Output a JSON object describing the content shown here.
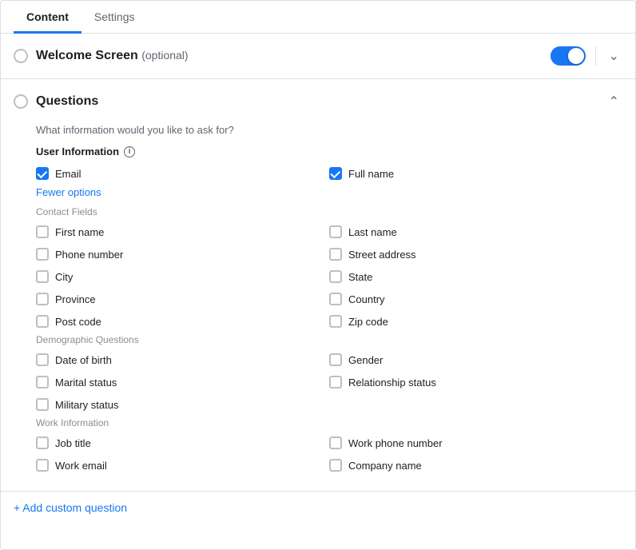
{
  "tabs": [
    {
      "id": "content",
      "label": "Content",
      "active": true
    },
    {
      "id": "settings",
      "label": "Settings",
      "active": false
    }
  ],
  "welcome_screen": {
    "title": "Welcome Screen",
    "optional_label": "(optional)",
    "toggle_on": true,
    "radio_selected": false
  },
  "questions": {
    "title": "Questions",
    "subtitle": "What information would you like to ask for?",
    "user_information": {
      "label": "User Information",
      "fields": [
        {
          "id": "email",
          "label": "Email",
          "checked": true
        },
        {
          "id": "full_name",
          "label": "Full name",
          "checked": true
        }
      ]
    },
    "fewer_options_label": "Fewer options",
    "contact_fields": {
      "label": "Contact Fields",
      "fields": [
        {
          "id": "first_name",
          "label": "First name",
          "checked": false,
          "col": 0
        },
        {
          "id": "last_name",
          "label": "Last name",
          "checked": false,
          "col": 1
        },
        {
          "id": "phone_number",
          "label": "Phone number",
          "checked": false,
          "col": 0
        },
        {
          "id": "street_address",
          "label": "Street address",
          "checked": false,
          "col": 1
        },
        {
          "id": "city",
          "label": "City",
          "checked": false,
          "col": 0
        },
        {
          "id": "state",
          "label": "State",
          "checked": false,
          "col": 1
        },
        {
          "id": "province",
          "label": "Province",
          "checked": false,
          "col": 0
        },
        {
          "id": "country",
          "label": "Country",
          "checked": false,
          "col": 1
        },
        {
          "id": "post_code",
          "label": "Post code",
          "checked": false,
          "col": 0
        },
        {
          "id": "zip_code",
          "label": "Zip code",
          "checked": false,
          "col": 1
        }
      ]
    },
    "demographic_questions": {
      "label": "Demographic Questions",
      "fields": [
        {
          "id": "date_of_birth",
          "label": "Date of birth",
          "checked": false,
          "col": 0
        },
        {
          "id": "gender",
          "label": "Gender",
          "checked": false,
          "col": 1
        },
        {
          "id": "marital_status",
          "label": "Marital status",
          "checked": false,
          "col": 0
        },
        {
          "id": "relationship_status",
          "label": "Relationship status",
          "checked": false,
          "col": 1
        },
        {
          "id": "military_status",
          "label": "Military status",
          "checked": false,
          "col": 0
        }
      ]
    },
    "work_information": {
      "label": "Work Information",
      "fields": [
        {
          "id": "job_title",
          "label": "Job title",
          "checked": false,
          "col": 0
        },
        {
          "id": "work_phone_number",
          "label": "Work phone number",
          "checked": false,
          "col": 1
        },
        {
          "id": "work_email",
          "label": "Work email",
          "checked": false,
          "col": 0
        },
        {
          "id": "company_name",
          "label": "Company name",
          "checked": false,
          "col": 1
        }
      ]
    },
    "add_custom_label": "+ Add custom question"
  }
}
